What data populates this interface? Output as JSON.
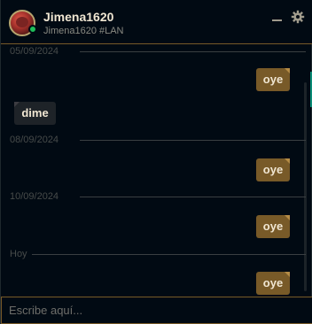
{
  "header": {
    "username": "Jimena1620",
    "riot_id": "Jimena1620 #LAN",
    "status": "online",
    "status_color": "#1ebe5a"
  },
  "icons": {
    "minimize": "minimize-icon",
    "settings": "gear-icon"
  },
  "messages": {
    "date_1": "05/09/2024",
    "msg_1": "oye",
    "msg_2": "dime",
    "date_2": "08/09/2024",
    "msg_3": "oye",
    "date_3": "10/09/2024",
    "msg_4": "oye",
    "date_4": "Hoy",
    "msg_5": "oye"
  },
  "input": {
    "placeholder": "Escribe aquí...",
    "value": ""
  },
  "colors": {
    "accent_gold": "#785a28",
    "background": "#010a13",
    "text_light": "#f0e6d2"
  }
}
